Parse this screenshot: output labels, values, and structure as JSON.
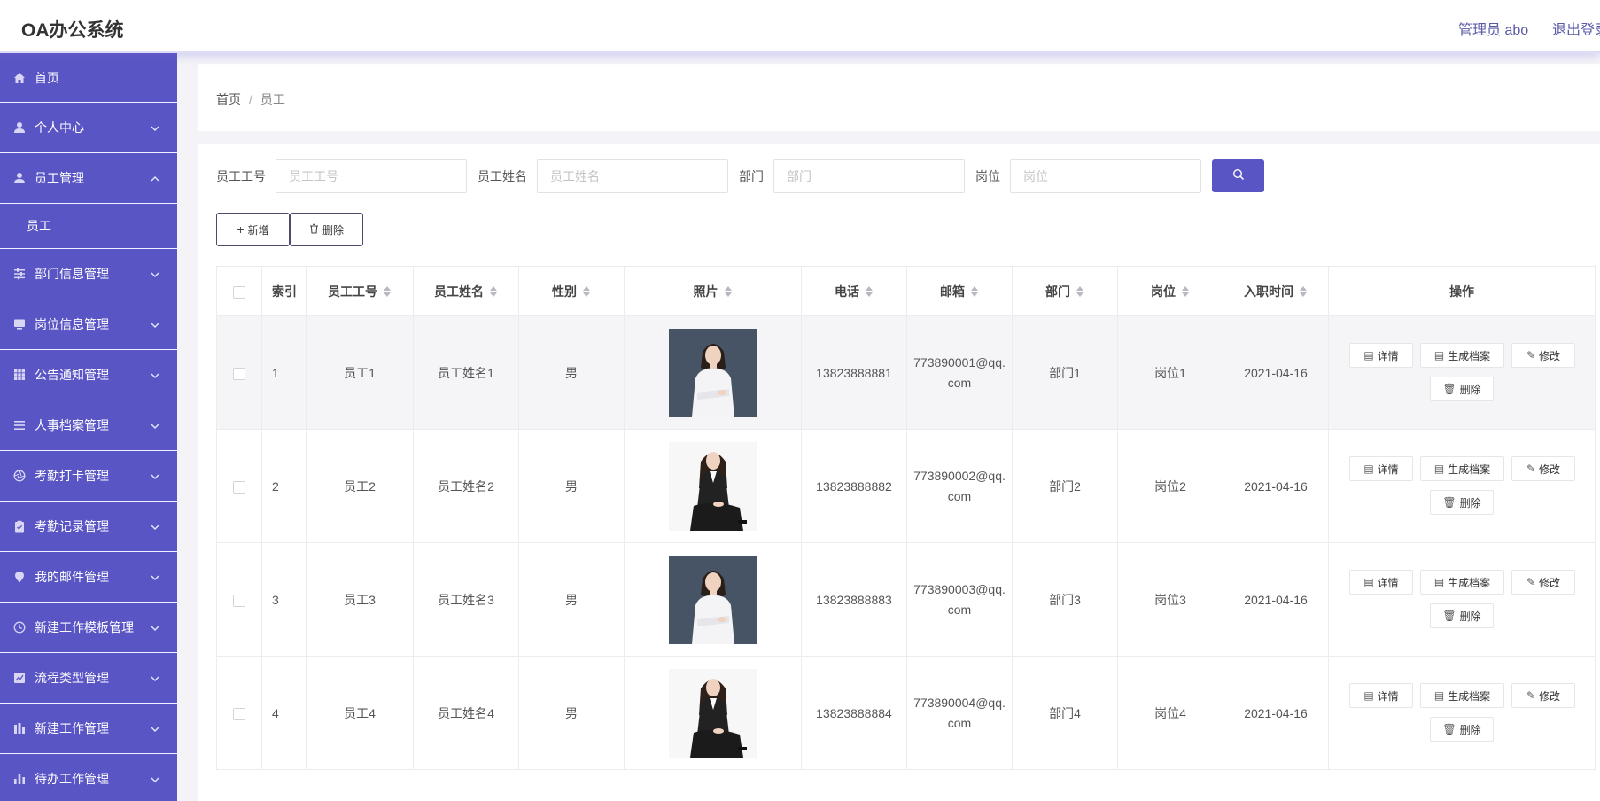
{
  "header": {
    "app_title": "OA办公系统",
    "user_label": "管理员 abo",
    "logout_label": "退出登录"
  },
  "sidebar": {
    "items": [
      {
        "label": "首页",
        "icon": "home-icon"
      },
      {
        "label": "个人中心",
        "icon": "user-icon"
      },
      {
        "label": "员工管理",
        "icon": "user-icon",
        "expanded": true
      },
      {
        "label": "员工",
        "sub": true
      },
      {
        "label": "部门信息管理",
        "icon": "sliders-icon"
      },
      {
        "label": "岗位信息管理",
        "icon": "monitor-icon"
      },
      {
        "label": "公告通知管理",
        "icon": "grid-icon"
      },
      {
        "label": "人事档案管理",
        "icon": "list-icon"
      },
      {
        "label": "考勤打卡管理",
        "icon": "aperture-icon"
      },
      {
        "label": "考勤记录管理",
        "icon": "clipboard-icon"
      },
      {
        "label": "我的邮件管理",
        "icon": "location-icon"
      },
      {
        "label": "新建工作模板管理",
        "icon": "clock-icon"
      },
      {
        "label": "流程类型管理",
        "icon": "chart-icon"
      },
      {
        "label": "新建工作管理",
        "icon": "building-icon"
      },
      {
        "label": "待办工作管理",
        "icon": "bar-chart-icon"
      }
    ]
  },
  "breadcrumb": {
    "home": "首页",
    "separator": "/",
    "current": "员工"
  },
  "search": {
    "fields": [
      {
        "label": "员工工号",
        "placeholder": "员工工号",
        "value": ""
      },
      {
        "label": "员工姓名",
        "placeholder": "员工姓名",
        "value": ""
      },
      {
        "label": "部门",
        "placeholder": "部门",
        "value": ""
      },
      {
        "label": "岗位",
        "placeholder": "岗位",
        "value": ""
      }
    ],
    "button_icon": "search-icon"
  },
  "toolbar": {
    "add_label": "新增",
    "delete_label": "删除"
  },
  "table": {
    "headers": [
      "索引",
      "员工工号",
      "员工姓名",
      "性别",
      "照片",
      "电话",
      "邮箱",
      "部门",
      "岗位",
      "入职时间",
      "操作"
    ],
    "actions": {
      "detail": "详情",
      "archive": "生成档案",
      "edit": "修改",
      "delete": "删除"
    },
    "rows": [
      {
        "index": "1",
        "emp_no": "员工1",
        "name": "员工姓名1",
        "gender": "男",
        "photo": "portrait-standing",
        "phone": "13823888881",
        "email": "773890001@qq.com",
        "dept": "部门1",
        "post": "岗位1",
        "date": "2021-04-16"
      },
      {
        "index": "2",
        "emp_no": "员工2",
        "name": "员工姓名2",
        "gender": "男",
        "photo": "portrait-seated",
        "phone": "13823888882",
        "email": "773890002@qq.com",
        "dept": "部门2",
        "post": "岗位2",
        "date": "2021-04-16"
      },
      {
        "index": "3",
        "emp_no": "员工3",
        "name": "员工姓名3",
        "gender": "男",
        "photo": "portrait-standing",
        "phone": "13823888883",
        "email": "773890003@qq.com",
        "dept": "部门3",
        "post": "岗位3",
        "date": "2021-04-16"
      },
      {
        "index": "4",
        "emp_no": "员工4",
        "name": "员工姓名4",
        "gender": "男",
        "photo": "portrait-seated",
        "phone": "13823888884",
        "email": "773890004@qq.com",
        "dept": "部门4",
        "post": "岗位4",
        "date": "2021-04-16"
      }
    ]
  },
  "colors": {
    "primary": "#5a55c4",
    "sidebar_bg": "#5a55c4",
    "highlight_row": "#f5f5f8"
  }
}
